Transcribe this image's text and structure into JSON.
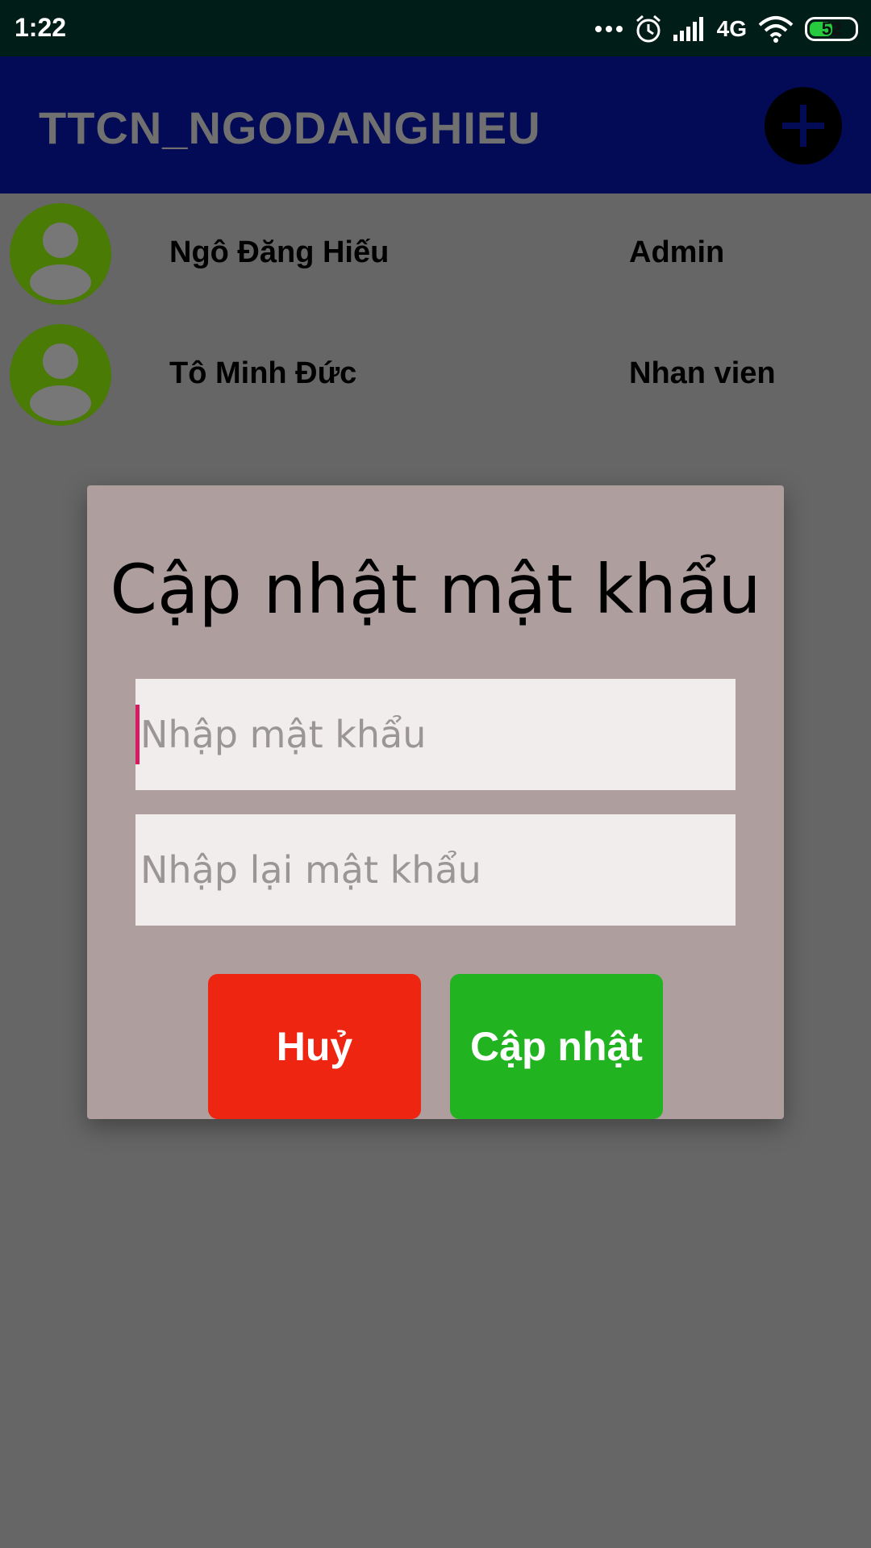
{
  "status_bar": {
    "time": "1:22",
    "network": "4G",
    "battery": "52",
    "battery_level": 0.52,
    "icons": [
      "more-dots-icon",
      "alarm-icon",
      "signal-icon",
      "wifi-icon",
      "battery-icon"
    ]
  },
  "app_bar": {
    "title": "TTCN_NGODANGHIEU",
    "add_icon": "plus-icon"
  },
  "users": [
    {
      "name": "Ngô Đăng Hiếu",
      "role": "Admin"
    },
    {
      "name": "Tô Minh Đức",
      "role": "Nhan vien"
    }
  ],
  "dialog": {
    "title": "Cập nhật mật khẩu",
    "password_placeholder": "Nhập mật khẩu",
    "password_value": "",
    "confirm_placeholder": "Nhập lại mật khẩu",
    "confirm_value": "",
    "cancel_label": "Huỷ",
    "update_label": "Cập nhật"
  },
  "colors": {
    "status_bar": "#001d18",
    "app_bar": "#040b56",
    "scrim": "#666666",
    "avatar": "#4a7b04",
    "dialog": "#ae9e9e",
    "cancel": "#ee2510",
    "update": "#22b321"
  }
}
